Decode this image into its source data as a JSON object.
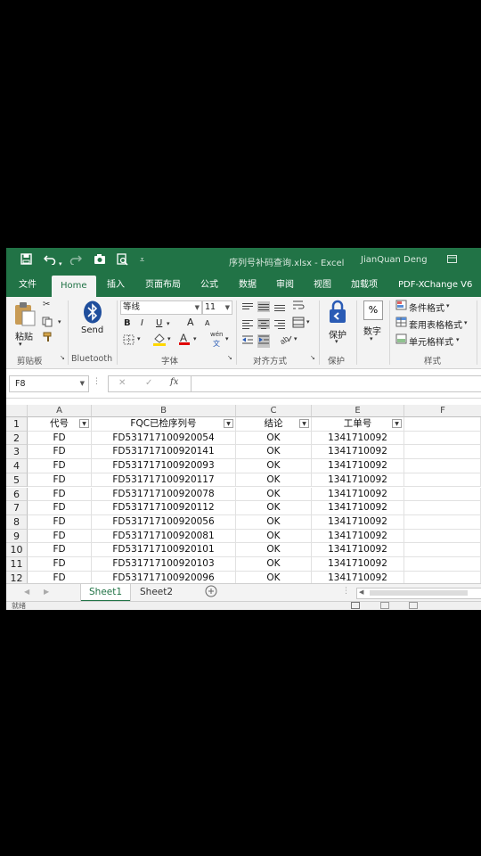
{
  "title_bar": {
    "save_icon": "save-icon",
    "undo_icon": "undo-icon",
    "redo_icon": "redo-icon",
    "title": "序列号补码查询.xlsx  -  Excel",
    "user": "JianQuan Deng"
  },
  "tabs": [
    "文件",
    "Home",
    "插入",
    "页面布局",
    "公式",
    "数据",
    "审阅",
    "视图",
    "加载项",
    "PDF-XChange V6"
  ],
  "active_tab": "Home",
  "ribbon": {
    "clipboard": {
      "paste_label": "粘贴",
      "group_label": "剪贴板"
    },
    "bluetooth": {
      "send_label": "Send",
      "group_label": "Bluetooth"
    },
    "font": {
      "font_name": "等线",
      "font_size": "11",
      "bold": "B",
      "italic": "I",
      "underline": "U",
      "grow": "A",
      "shrink": "A",
      "phonetic": "wén",
      "group_label": "字体"
    },
    "alignment": {
      "group_label": "对齐方式"
    },
    "protect": {
      "label": "保护",
      "group_label": "保护"
    },
    "number": {
      "label": "数字",
      "icon_text": "%"
    },
    "styles": {
      "conditional": "条件格式",
      "table_format": "套用表格格式",
      "cell_styles": "单元格样式",
      "group_label": "样式"
    }
  },
  "formula_bar": {
    "name_box": "F8",
    "cancel": "✕",
    "enter": "✓",
    "fx": "fx",
    "value": ""
  },
  "grid": {
    "columns": [
      "A",
      "B",
      "C",
      "E",
      "F"
    ],
    "headers": [
      "代号",
      "FQC已检序列号",
      "结论",
      "工单号"
    ],
    "rows": [
      {
        "n": "1"
      },
      {
        "n": "2",
        "a": "FD",
        "b": "FD531717100920054",
        "c": "OK",
        "e": "1341710092"
      },
      {
        "n": "3",
        "a": "FD",
        "b": "FD531717100920141",
        "c": "OK",
        "e": "1341710092"
      },
      {
        "n": "4",
        "a": "FD",
        "b": "FD531717100920093",
        "c": "OK",
        "e": "1341710092"
      },
      {
        "n": "5",
        "a": "FD",
        "b": "FD531717100920117",
        "c": "OK",
        "e": "1341710092"
      },
      {
        "n": "6",
        "a": "FD",
        "b": "FD531717100920078",
        "c": "OK",
        "e": "1341710092"
      },
      {
        "n": "7",
        "a": "FD",
        "b": "FD531717100920112",
        "c": "OK",
        "e": "1341710092"
      },
      {
        "n": "8",
        "a": "FD",
        "b": "FD531717100920056",
        "c": "OK",
        "e": "1341710092"
      },
      {
        "n": "9",
        "a": "FD",
        "b": "FD531717100920081",
        "c": "OK",
        "e": "1341710092"
      },
      {
        "n": "10",
        "a": "FD",
        "b": "FD531717100920101",
        "c": "OK",
        "e": "1341710092"
      },
      {
        "n": "11",
        "a": "FD",
        "b": "FD531717100920103",
        "c": "OK",
        "e": "1341710092"
      },
      {
        "n": "12",
        "a": "FD",
        "b": "FD531717100920096",
        "c": "OK",
        "e": "1341710092"
      }
    ]
  },
  "sheets": [
    "Sheet1",
    "Sheet2"
  ],
  "active_sheet": "Sheet1",
  "status": "就绪",
  "colors": {
    "excel_green": "#217346"
  }
}
